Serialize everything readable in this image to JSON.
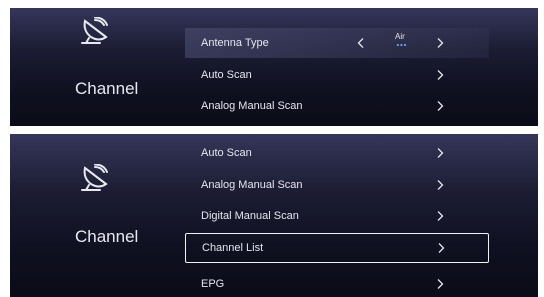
{
  "panel_top": {
    "section_title": "Channel",
    "items": [
      {
        "label": "Antenna Type",
        "value": "Air",
        "control": "selector"
      },
      {
        "label": "Auto Scan"
      },
      {
        "label": "Analog Manual Scan"
      }
    ]
  },
  "panel_bottom": {
    "section_title": "Channel",
    "items": [
      {
        "label": "Auto Scan"
      },
      {
        "label": "Analog Manual Scan"
      },
      {
        "label": "Digital Manual Scan"
      },
      {
        "label": "Channel List",
        "focused": true
      },
      {
        "label": "EPG"
      }
    ]
  },
  "icons": {
    "section": "satellite-dish-icon",
    "next": "chevron-right-icon",
    "prev": "chevron-left-icon"
  },
  "colors": {
    "text": "#e6e6ee",
    "focus_border": "#f2f2f2",
    "panel_bg_top": "#35365a",
    "panel_bg_bottom": "#0c0c18"
  }
}
